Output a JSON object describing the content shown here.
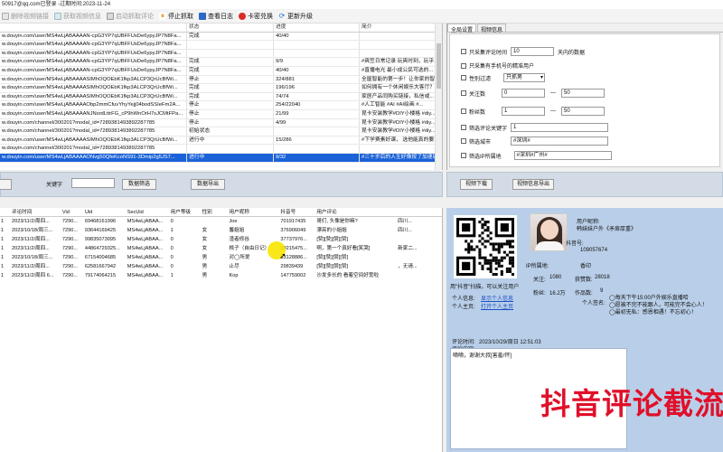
{
  "title": "50917@qq.com已登录 -过期时间:2023-11-24",
  "toolbar": {
    "delete_label": "删除视频链接",
    "get_label": "获取视频信息",
    "start_label": "启动抓取评论",
    "stop_label": "停止抓取",
    "log_label": "查看日志",
    "card_label": "卡密兑换",
    "upgrade_label": "更新升级"
  },
  "url_table": {
    "headers": {
      "url": "",
      "status": "状态",
      "progress": "进度",
      "intro": "简介"
    },
    "rows": [
      {
        "url": "w.douyin.com/user/MS4wLjABAAAAN-cpG3YP7qUBFFUsDe6ypyJP7N8Fa...",
        "status": "完成",
        "progress": "40/40",
        "intro": ""
      },
      {
        "url": "w.douyin.com/user/MS4wLjABAAAAN-cpG3YP7qUBFFUsDe6ypyJP7N8Fa...",
        "status": "",
        "progress": "",
        "intro": ""
      },
      {
        "url": "w.douyin.com/user/MS4wLjABAAAAN-cpG3YP7qUBFFUsDe6ypyJP7N8Fa...",
        "status": "",
        "progress": "",
        "intro": ""
      },
      {
        "url": "w.douyin.com/user/MS4wLjABAAAAN-cpG3YP7qUBFFUsDe6ypyJP7N8Fa...",
        "status": "完成",
        "progress": "9/9",
        "intro": "#爽笠日常记录 玩爽时刻，玩乎..."
      },
      {
        "url": "w.douyin.com/user/MS4wLjABAAAAN-cpG3YP7qUBFFUsDe6ypyJP7N8Fa...",
        "status": "完成",
        "progress": "40/40",
        "intro": "#直播电光 最小成公民可选的..."
      },
      {
        "url": "w.douyin.com/user/MS4wLjABAAAASIMhOQOEbK1fkp3ALCP3QrUcBfWi...",
        "status": "停止",
        "progress": "324/881",
        "intro": "全屋智能的第一步！让你家的智..."
      },
      {
        "url": "w.douyin.com/user/MS4wLjABAAAASIMhOQOEbK1fkp3ALCP3QrUcBfWi...",
        "status": "完成",
        "progress": "196/196",
        "intro": "如何拥有一个休闲娱乐大客厅？..."
      },
      {
        "url": "w.douyin.com/user/MS4wLjABAAAASIMhOQOEbK1fkp3ALCP3QrUcBfWi...",
        "status": "完成",
        "progress": "74/74",
        "intro": "家居产品同购买链接，私信或..."
      },
      {
        "url": "w.douyin.com/user/MS4wLjABAAAAObp2mmCfuvYhyYejj04bodSSIeFm2A...",
        "status": "停止",
        "progress": "254/22040",
        "intro": "#人工智能 #AI #AI绘画 #..."
      },
      {
        "url": "w.douyin.com/user/MS4wLjABAAAANJNsrdLttrFG_cP9hWnOrH7sJCMtFPa...",
        "status": "停止",
        "progress": "21/99",
        "intro": "昆卡安装教学#DIY小楼格 #diy..."
      },
      {
        "url": "w.douyin.com/channel/300201?modal_id=7289381493892287785",
        "status": "停止",
        "progress": "4/99",
        "intro": "昆卡安装教学#DIY小楼格 #diy..."
      },
      {
        "url": "w.douyin.com/channel/300201?modal_id=7289381493892287785",
        "status": "初始状态",
        "progress": "",
        "intro": "昆卡安装教学#DIY小楼格 #diy..."
      },
      {
        "url": "w.douyin.com/user/MS4wLjABAAAASIMhOQOEbK1fkp3ALCP3QrUcBfWi...",
        "status": "进行中",
        "progress": "15/286",
        "intro": "#下学费素好课， 选他能真的要..."
      },
      {
        "url": "w.douyin.com/channel/300201?modal_id=7289381493892287785",
        "status": "",
        "progress": "",
        "intro": ""
      },
      {
        "url": "w.douyin.com/user/MS4wLjABAAAAONvg50QfeKcoNS91-3Dmip2g5JS7...",
        "status": "进行中",
        "progress": "9/32",
        "intro": "#三十岁后的人生好像按了加速键..."
      }
    ]
  },
  "settings": {
    "tab_global": "全局设置",
    "tab_video": "视频信息",
    "only_recent_label": "只采集评论时间",
    "only_recent_value": "10",
    "only_recent_unit": "天内的数据",
    "only_phone_label": "只采集有手机号的精准用户",
    "gender_label": "性别过滤",
    "gender_value": "只抓男",
    "fans_label": "关注数",
    "fans_min": "0",
    "fans_max": "50",
    "follow_label": "粉丝数",
    "follow_min": "1",
    "follow_max": "50",
    "keyword_label": "筛选评论关键字",
    "keyword_value": "1",
    "city_label": "筛选城市",
    "city_value": "#深圳#",
    "ip_label": "筛选IP所属地",
    "ip_value": "#深圳#广州#"
  },
  "midbar": {
    "left_btn": "",
    "keyword_label": "关键字",
    "filter_btn": "数据筛选",
    "export_btn": "数据导出",
    "video_download": "视频下载",
    "video_export": "视频信息导出"
  },
  "comments": {
    "headers": [
      "",
      "评论时间",
      "Vid",
      "Uid",
      "SecUid",
      "用户等级",
      "性别",
      "用户昵称",
      "抖音号",
      "用户评论",
      ""
    ],
    "rows": [
      [
        "1",
        "2023/11/2/周四...",
        "7290...",
        "69468161996",
        "MS4wLjABAA...",
        "0",
        "",
        "Joe",
        "701917435",
        "哥们, 头像是你嘛?",
        "四川..."
      ],
      [
        "1",
        "2023/10/18/周三...",
        "7290...",
        "93644169425",
        "MS4wLjABAA...",
        "1",
        "女",
        "馨姐姐",
        "376906049",
        "漂亮的小姐姐",
        "四川..."
      ],
      [
        "1",
        "2023/11/2/周四...",
        "7290...",
        "99835073095",
        "MS4wLjABAA...",
        "0",
        "女",
        "渣者修谷",
        "37737976...",
        "[赞][赞][赞][赞]",
        ""
      ],
      [
        "1",
        "2023/11/2/周四...",
        "7290...",
        "44864729325...",
        "MS4wLjABAA...",
        "0",
        "女",
        "桃子（自由日记）",
        "89215475...",
        "啊，第一个真好看[笑哭]",
        "新家二..."
      ],
      [
        "1",
        "2023/10/18/周三...",
        "7290...",
        "67154004685",
        "MS4wLjABAA...",
        "0",
        "男",
        "对◯所爱",
        "83128886...",
        "[赞][赞][赞][赞]",
        ""
      ],
      [
        "1",
        "2023/11/2/周四...",
        "7290...",
        "62581667942",
        "MS4wLjABAA...",
        "0",
        "男",
        "止尽",
        "29839439",
        "[赞][赞][赞][赞]",
        "，无请..."
      ],
      [
        "1",
        "2023/11/2/周四 6...",
        "7290...",
        "79174064215",
        "MS4wLjABAA...",
        "1",
        "男",
        "Kop",
        "147759002",
        "沙发多长的 看着空间好宽啦",
        ""
      ]
    ]
  },
  "profile": {
    "qr_caption": "用\"抖音\"扫描，可以关注用户",
    "nick_label": "用户昵称:",
    "nick_value": "韩妹妹户外《矛扉厚重》",
    "douyin_label": "抖音号:",
    "douyin_value": "109057674",
    "ip_label": "IP所属地:",
    "ip_value": "香印",
    "follow_label": "关注:",
    "follow_value": "1080",
    "liked_label": "获赞数:",
    "liked_value": "28018",
    "fans_label": "粉丝:",
    "fans_value": "16.2万",
    "works_label": "作品数:",
    "works_value": "9",
    "info_label": "个人信息:",
    "info_link": "显示个人信息",
    "home_label": "个人主页:",
    "home_link": "打开个人主页",
    "sign_label": "个人签名:",
    "sign_lines": [
      "◯每天下午15:00户外娱乐直播哈",
      "◯愿被不完不能跟人，可能完不会心人！",
      "◯最初无私：感恩相遇！不忘初心！"
    ],
    "time_label": "评论时间:",
    "time_value": "2023/10/29/周日 12:51:03",
    "content_label": "评论内容:",
    "content_value": "嘀嘀，谢谢大叔[害羞/怀]"
  },
  "watermark": "抖音评论截流"
}
